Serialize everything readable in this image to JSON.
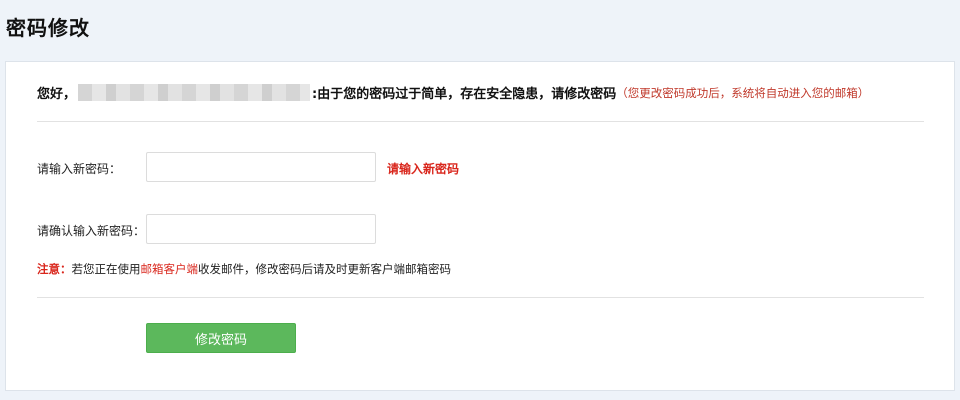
{
  "page": {
    "title": "密码修改"
  },
  "greeting": {
    "prefix": "您好，",
    "message": ":由于您的密码过于简单，存在安全隐患，请修改密码",
    "hint": "（您更改密码成功后，系统将自动进入您的邮箱）"
  },
  "form": {
    "new_password_label": "请输入新密码：",
    "new_password_value": "",
    "new_password_error": "请输入新密码",
    "confirm_password_label": "请确认输入新密码：",
    "confirm_password_value": ""
  },
  "notice": {
    "label": "注意：",
    "text_before": "若您正在使用",
    "highlight": "邮箱客户端",
    "text_after": "收发邮件，修改密码后请及时更新客户端邮箱密码"
  },
  "actions": {
    "submit_label": "修改密码"
  },
  "colors": {
    "background": "#eef3f9",
    "accent_green": "#5cb85c",
    "error_red": "#d9261c"
  }
}
